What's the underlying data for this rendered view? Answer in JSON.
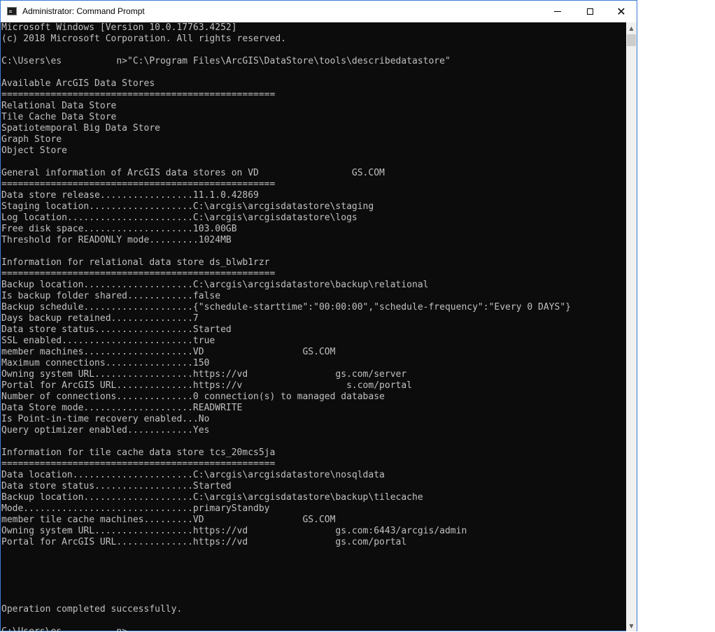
{
  "window": {
    "title": "Administrator: Command Prompt",
    "icon": "cmd-icon"
  },
  "controls": {
    "minimize": "minimize-icon",
    "maximize": "maximize-icon",
    "close": "close-icon",
    "close_glyph": "✕"
  },
  "scrollbar": {
    "up_glyph": "▲",
    "down_glyph": "▼"
  },
  "console": {
    "lines": [
      "Microsoft Windows [Version 10.0.17763.4252]",
      "(c) 2018 Microsoft Corporation. All rights reserved.",
      "",
      "C:\\Users\\es          n>\"C:\\Program Files\\ArcGIS\\DataStore\\tools\\describedatastore\"",
      "",
      "Available ArcGIS Data Stores",
      "==================================================",
      "Relational Data Store",
      "Tile Cache Data Store",
      "Spatiotemporal Big Data Store",
      "Graph Store",
      "Object Store",
      "",
      "General information of ArcGIS data stores on VD                 GS.COM",
      "==================================================",
      "Data store release.................11.1.0.42869",
      "Staging location...................C:\\arcgis\\arcgisdatastore\\staging",
      "Log location.......................C:\\arcgis\\arcgisdatastore\\logs",
      "Free disk space....................103.00GB",
      "Threshold for READONLY mode.........1024MB",
      "",
      "Information for relational data store ds_blwb1rzr",
      "==================================================",
      "Backup location....................C:\\arcgis\\arcgisdatastore\\backup\\relational",
      "Is backup folder shared............false",
      "Backup schedule....................{\"schedule-starttime\":\"00:00:00\",\"schedule-frequency\":\"Every 0 DAYS\"}",
      "Days backup retained...............7",
      "Data store status..................Started",
      "SSL enabled........................true",
      "member machines....................VD                  GS.COM",
      "Maximum connections................150",
      "Owning system URL..................https://vd                gs.com/server",
      "Portal for ArcGIS URL..............https://v                   s.com/portal",
      "Number of connections..............0 connection(s) to managed database",
      "Data Store mode....................READWRITE",
      "Is Point-in-time recovery enabled...No",
      "Query optimizer enabled............Yes",
      "",
      "Information for tile cache data store tcs_20mcs5ja",
      "==================================================",
      "Data location......................C:\\arcgis\\arcgisdatastore\\nosqldata",
      "Data store status..................Started",
      "Backup location....................C:\\arcgis\\arcgisdatastore\\backup\\tilecache",
      "Mode...............................primaryStandby",
      "member tile cache machines.........VD                  GS.COM",
      "Owning system URL..................https://vd                gs.com:6443/arcgis/admin",
      "Portal for ArcGIS URL..............https://vd                gs.com/portal",
      "",
      "",
      "",
      "",
      "",
      "Operation completed successfully.",
      "",
      "C:\\Users\\es          n>"
    ]
  }
}
